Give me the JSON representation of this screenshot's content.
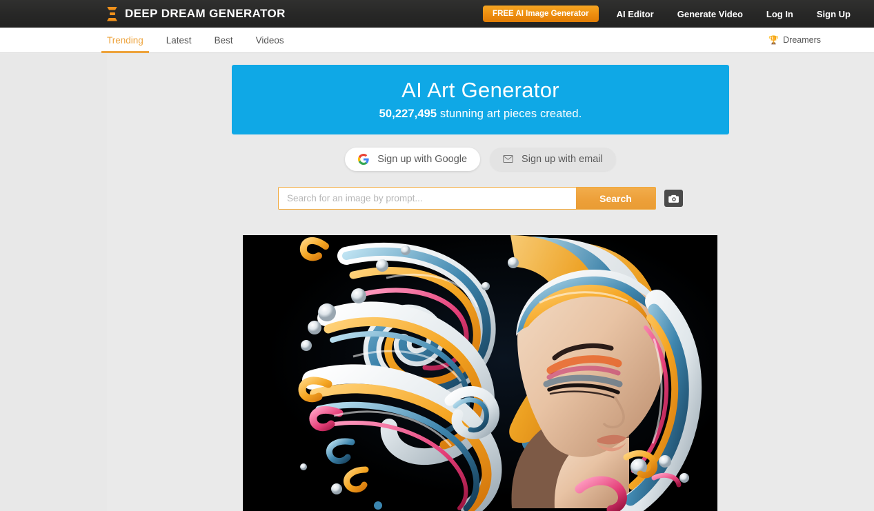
{
  "header": {
    "logo_icon": "hourglass-logo-icon",
    "brand": "DEEP DREAM GENERATOR",
    "cta_label": "FREE AI Image Generator",
    "nav": [
      {
        "label": "AI Editor"
      },
      {
        "label": "Generate Video"
      },
      {
        "label": "Log In"
      },
      {
        "label": "Sign Up"
      }
    ]
  },
  "subnav": {
    "items": [
      {
        "label": "Trending",
        "active": true
      },
      {
        "label": "Latest",
        "active": false
      },
      {
        "label": "Best",
        "active": false
      },
      {
        "label": "Videos",
        "active": false
      }
    ],
    "dreamers": {
      "icon": "trophy-icon",
      "label": "Dreamers"
    }
  },
  "hero": {
    "title": "AI Art Generator",
    "count": "50,227,495",
    "subtitle_rest": " stunning art pieces created.",
    "background_color": "#0fa8e6"
  },
  "signup": {
    "google": {
      "icon": "google-g-icon",
      "label": "Sign up with Google"
    },
    "email": {
      "icon": "envelope-icon",
      "label": "Sign up with email"
    }
  },
  "search": {
    "placeholder": "Search for an image by prompt...",
    "value": "",
    "button_label": "Search",
    "camera_icon": "camera-icon"
  },
  "artwork": {
    "alt": "Surreal portrait of a woman with flowing liquid swirl hair in orange, blue, white and pink on black background"
  },
  "colors": {
    "accent_orange": "#eda33c",
    "brand_orange": "#f0911a",
    "hero_blue": "#0fa8e6",
    "header_dark": "#272726",
    "page_bg": "#e8e8e8"
  }
}
